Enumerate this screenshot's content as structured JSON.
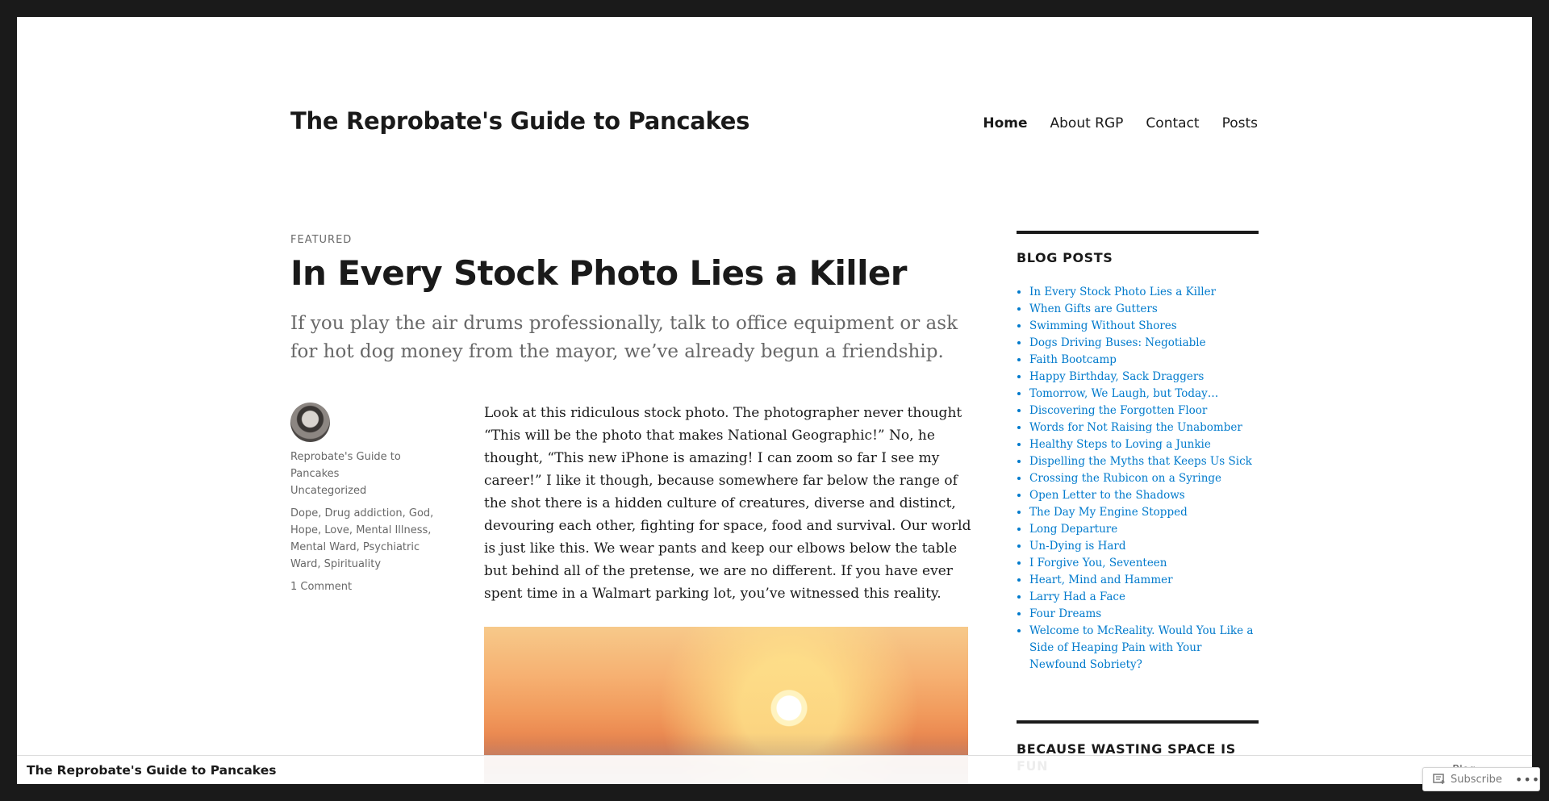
{
  "site": {
    "title": "The Reprobate's Guide to Pancakes"
  },
  "nav": [
    {
      "label": "Home"
    },
    {
      "label": "About RGP"
    },
    {
      "label": "Contact"
    },
    {
      "label": "Posts"
    }
  ],
  "post": {
    "featured_label": "FEATURED",
    "title": "In Every Stock Photo Lies a Killer",
    "excerpt": "If you play the air drums professionally, talk to office equipment or ask for hot dog money from the mayor, we’ve already begun a friendship.",
    "author": "Reprobate's Guide to Pancakes",
    "category": "Uncategorized",
    "tags": [
      "Dope",
      "Drug addiction",
      "God",
      "Hope",
      "Love",
      "Mental Illness",
      "Mental Ward",
      "Psychiatric Ward",
      "Spirituality"
    ],
    "comments": "1 Comment",
    "body": "Look at this ridiculous stock photo. The photographer never thought “This will be the photo that makes National Geographic!” No, he thought, “This new iPhone is amazing! I can zoom so far I see my career!” I like it though, because somewhere far below the range of the shot there is a hidden culture of creatures, diverse and distinct, devouring each other, fighting for space, food and survival. Our world is just like this. We wear pants and keep our elbows below the table but behind all of the pretense, we are no different. If you have ever spent time in a Walmart parking lot, you’ve witnessed this reality."
  },
  "sidebar": {
    "blog_posts_title": "BLOG POSTS",
    "posts": [
      "In Every Stock Photo Lies a Killer",
      "When Gifts are Gutters",
      "Swimming Without Shores",
      "Dogs Driving Buses: Negotiable",
      "Faith Bootcamp",
      "Happy Birthday, Sack Draggers",
      "Tomorrow, We Laugh, but Today…",
      "Discovering the Forgotten Floor",
      "Words for Not Raising the Unabomber",
      "Healthy Steps to Loving a Junkie",
      "Dispelling the Myths that Keeps Us Sick",
      "Crossing the Rubicon on a Syringe",
      "Open Letter to the Shadows",
      "The Day My Engine Stopped",
      "Long Departure",
      "Un-Dying is Hard",
      "I Forgive You, Seventeen",
      "Heart, Mind and Hammer",
      "Larry Had a Face",
      "Four Dreams",
      "Welcome to McReality. Would You Like a Side of Heaping Pain with Your Newfound Sobriety?"
    ],
    "second_widget_title": "BECAUSE WASTING SPACE IS FUN"
  },
  "bottom_bar": {
    "title": "The Reprobate's Guide to Pancakes",
    "blog_label": "Blog",
    "subscribe_label": "Subscribe",
    "more_label": "•••"
  },
  "colors": {
    "link": "#007acc",
    "text": "#1a1a1a",
    "muted": "#686868",
    "frame": "#1a1a1a"
  }
}
